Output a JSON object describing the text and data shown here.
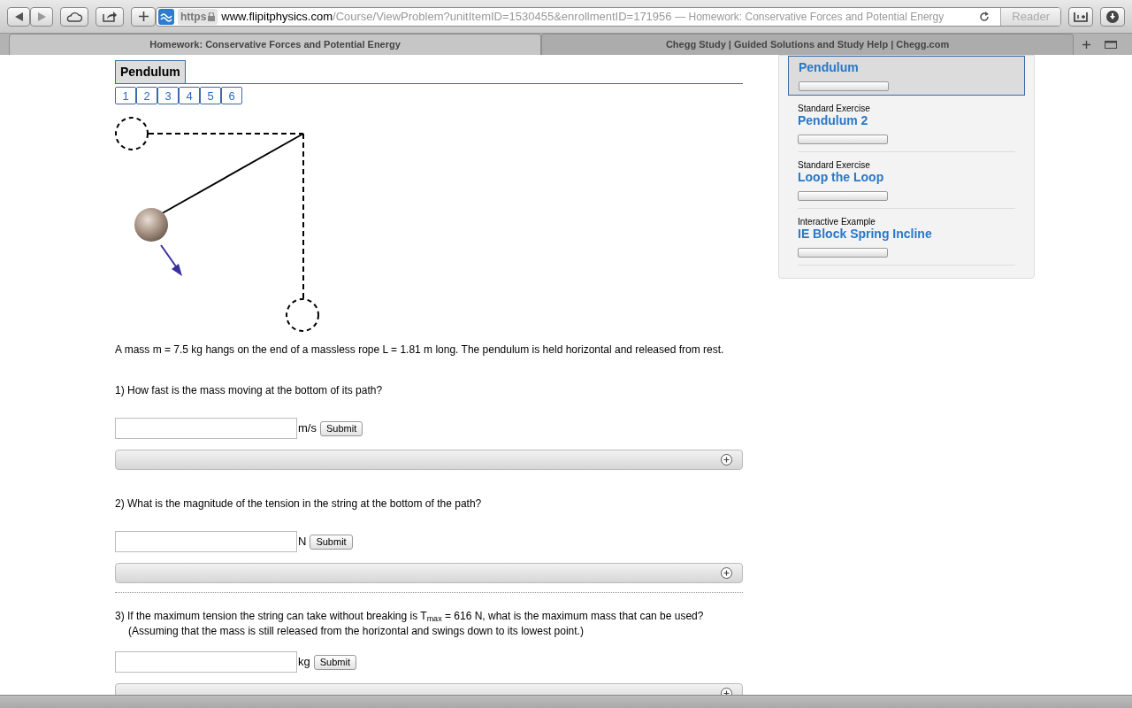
{
  "browser": {
    "scheme": "https",
    "url_domain": "www.flipitphysics.com",
    "url_path": "/Course/ViewProblem?unitItemID=1530455&enrollmentID=171956",
    "page_title": "— Homework: Conservative Forces and Potential Energy",
    "reader": "Reader",
    "tabs": [
      {
        "title": "Homework: Conservative Forces and Potential Energy",
        "selected": true
      },
      {
        "title": "Chegg Study | Guided Solutions and Study Help | Chegg.com",
        "selected": false
      }
    ]
  },
  "problem": {
    "title": "Pendulum",
    "pages": [
      {
        "label": "1",
        "selected": false
      },
      {
        "label": "2",
        "selected": false
      },
      {
        "label": "3",
        "selected": false
      },
      {
        "label": "4",
        "selected": false
      },
      {
        "label": "5",
        "selected": false
      },
      {
        "label": "6",
        "selected": false
      }
    ],
    "statement": "A mass m = 7.5 kg hangs on the end of a massless rope L = 1.81 m long. The pendulum is held horizontal and released from rest.",
    "questions": [
      {
        "text": "1) How fast is the mass moving at the bottom of its path?",
        "unit": "m/s",
        "button": "Submit",
        "expanded": false
      },
      {
        "text": "2) What is the magnitude of the tension in the string at the bottom of the path?",
        "unit": "N",
        "button": "Submit",
        "expanded": false
      },
      {
        "text": "3) If the maximum tension the string can take without breaking is T$_{max}$ = 616 N, what is the maximum mass that can be used? (Assuming that the mass is still released from the horizontal and swings down to its lowest point.)",
        "unit": "kg",
        "button": "Submit"
      }
    ]
  },
  "sidebar": {
    "items": [
      {
        "title": "Pendulum",
        "selected": true
      },
      {
        "type": "Standard Exercise",
        "title": "Pendulum 2",
        "selected": false
      },
      {
        "type": "Standard Exercise",
        "title": "Loop the Loop",
        "selected": false
      },
      {
        "type": "Interactive Example",
        "title": "IE Block Spring Incline",
        "selected": false
      }
    ]
  }
}
